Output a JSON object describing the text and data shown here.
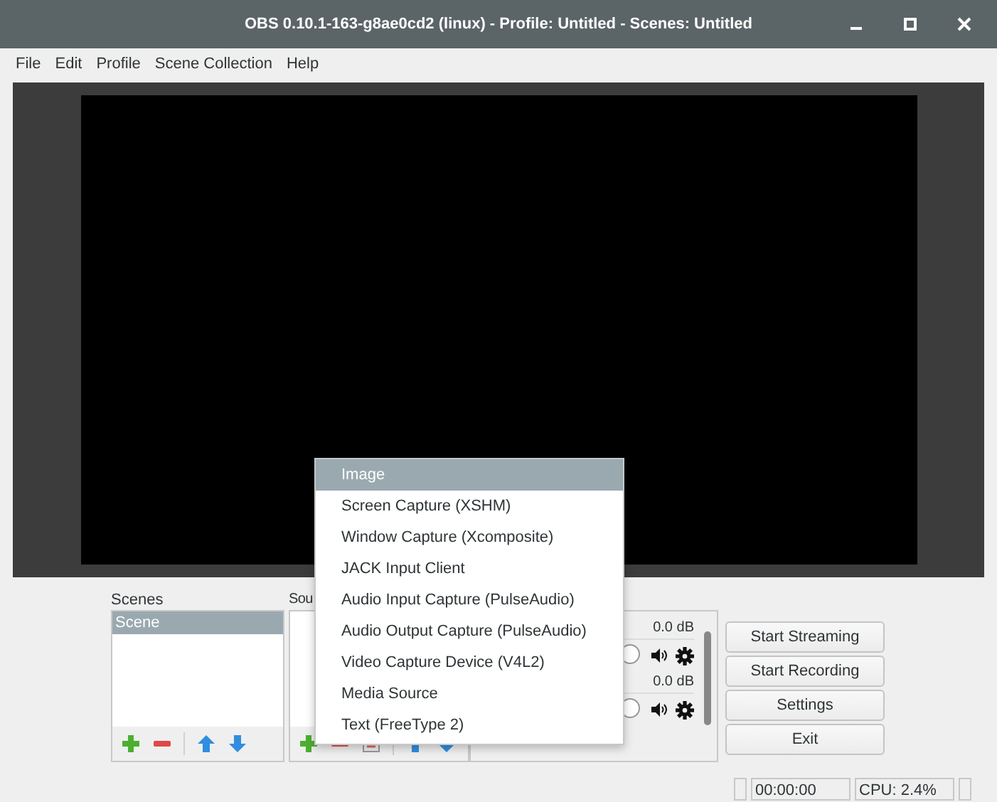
{
  "window": {
    "title": "OBS 0.10.1-163-g8ae0cd2 (linux) - Profile: Untitled - Scenes: Untitled"
  },
  "menu_bar": [
    "File",
    "Edit",
    "Profile",
    "Scene Collection",
    "Help"
  ],
  "scenes": {
    "label": "Scenes",
    "items": [
      {
        "name": "Scene",
        "selected": true
      }
    ]
  },
  "sources": {
    "label": "Sou"
  },
  "mixer": {
    "channels": [
      {
        "reading": "0.0 dB",
        "level": 1
      },
      {
        "reading": "0.0 dB",
        "level": 1
      }
    ]
  },
  "controls": [
    "Start Streaming",
    "Start Recording",
    "Settings",
    "Exit"
  ],
  "status_bar": {
    "time": "00:00:00",
    "cpu": "CPU: 2.4%"
  },
  "add_source_menu": [
    {
      "label": "Image",
      "selected": true
    },
    {
      "label": "Screen Capture (XSHM)",
      "selected": false
    },
    {
      "label": "Window Capture (Xcomposite)",
      "selected": false
    },
    {
      "label": "JACK Input Client",
      "selected": false
    },
    {
      "label": "Audio Input Capture (PulseAudio)",
      "selected": false
    },
    {
      "label": "Audio Output Capture (PulseAudio)",
      "selected": false
    },
    {
      "label": "Video Capture Device (V4L2)",
      "selected": false
    },
    {
      "label": "Media Source",
      "selected": false
    },
    {
      "label": "Text (FreeType 2)",
      "selected": false
    }
  ]
}
